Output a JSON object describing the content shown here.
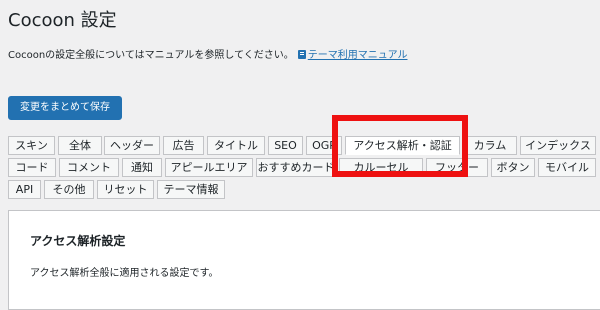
{
  "header": {
    "title": "Cocoon 設定"
  },
  "intro": {
    "text": "Cocoonの設定全般についてはマニュアルを参照してください。",
    "link": "テーマ利用マニュアル"
  },
  "toolbar": {
    "save_label": "変更をまとめて保存"
  },
  "tabs": {
    "row1": [
      "スキン",
      "全体",
      "ヘッダー",
      "広告",
      "タイトル",
      "SEO",
      "OGP",
      "アクセス解析・認証",
      "カラム",
      "インデックス"
    ],
    "row2": [
      "コード",
      "コメント",
      "通知",
      "アピールエリア",
      "おすすめカード",
      "カルーセル",
      "フッター",
      "ボタン",
      "モバイル"
    ],
    "row3": [
      "API",
      "その他",
      "リセット",
      "テーマ情報"
    ]
  },
  "active_tab": "アクセス解析・認証",
  "panel": {
    "title": "アクセス解析設定",
    "description": "アクセス解析全般に適用される設定です。"
  },
  "colors": {
    "accent": "#2271b1",
    "highlight": "#ee1111",
    "background": "#f0f0f1"
  }
}
